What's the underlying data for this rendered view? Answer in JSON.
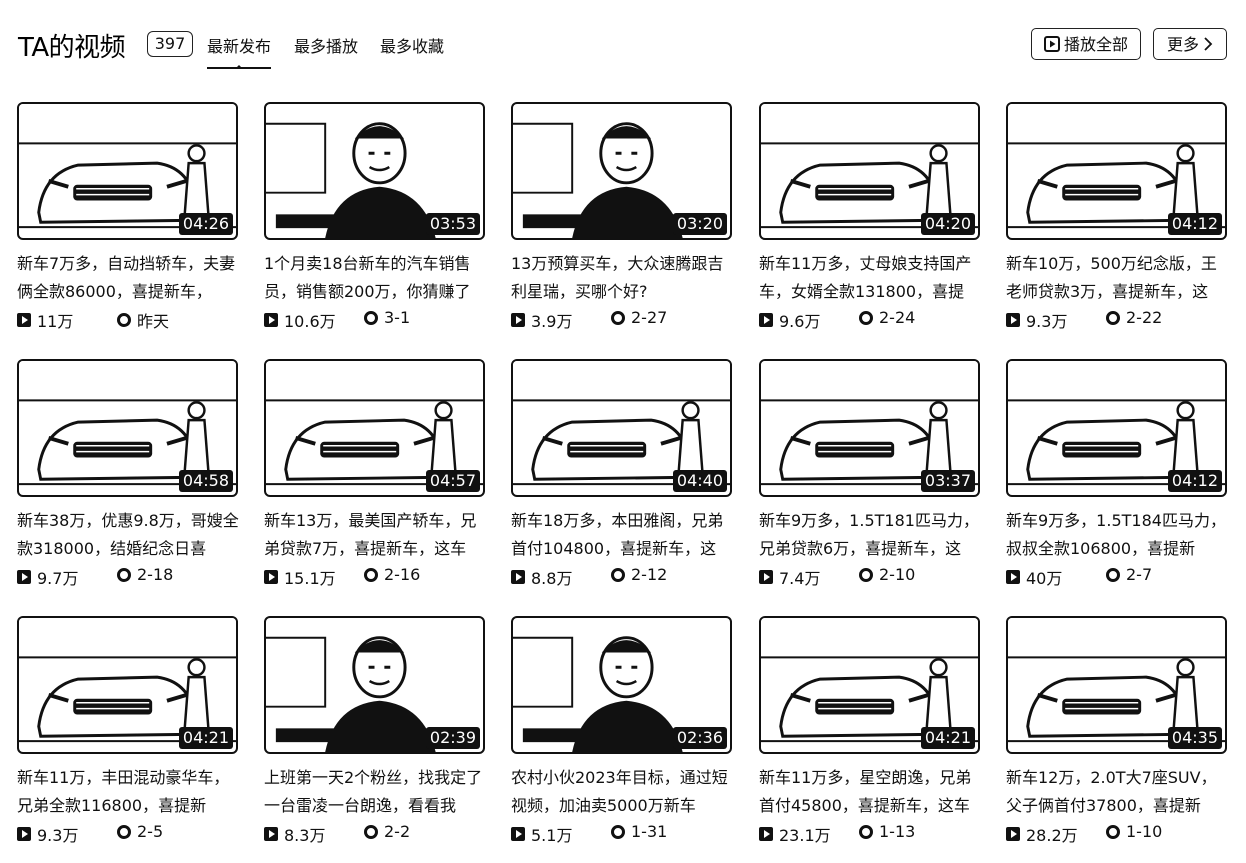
{
  "header": {
    "title": "TA的视频",
    "count": "397",
    "tabs": [
      "最新发布",
      "最多播放",
      "最多收藏"
    ],
    "play_all_label": "播放全部",
    "more_label": "更多"
  },
  "videos": [
    {
      "title": "新车7万多，自动挡轿车，夫妻俩全款86000，喜提新车，",
      "views": "11万",
      "date": "昨天",
      "duration": "04:26"
    },
    {
      "title": "1个月卖18台新车的汽车销售员，销售额200万，你猜赚了",
      "views": "10.6万",
      "date": "3-1",
      "duration": "03:53"
    },
    {
      "title": "13万预算买车，大众速腾跟吉利星瑞，买哪个好?",
      "views": "3.9万",
      "date": "2-27",
      "duration": "03:20"
    },
    {
      "title": "新车11万多，丈母娘支持国产车，女婿全款131800，喜提",
      "views": "9.6万",
      "date": "2-24",
      "duration": "04:20"
    },
    {
      "title": "新车10万，500万纪念版，王老师贷款3万，喜提新车，这",
      "views": "9.3万",
      "date": "2-22",
      "duration": "04:12"
    },
    {
      "title": "新车38万，优惠9.8万，哥嫂全款318000，结婚纪念日喜",
      "views": "9.7万",
      "date": "2-18",
      "duration": "04:58"
    },
    {
      "title": "新车13万，最美国产轿车，兄弟贷款7万，喜提新车，这车",
      "views": "15.1万",
      "date": "2-16",
      "duration": "04:57"
    },
    {
      "title": "新车18万多，本田雅阁，兄弟首付104800，喜提新车，这",
      "views": "8.8万",
      "date": "2-12",
      "duration": "04:40"
    },
    {
      "title": "新车9万多，1.5T181匹马力，兄弟贷款6万，喜提新车，这",
      "views": "7.4万",
      "date": "2-10",
      "duration": "03:37"
    },
    {
      "title": "新车9万多，1.5T184匹马力，叔叔全款106800，喜提新",
      "views": "40万",
      "date": "2-7",
      "duration": "04:12"
    },
    {
      "title": "新车11万，丰田混动豪华车，兄弟全款116800，喜提新",
      "views": "9.3万",
      "date": "2-5",
      "duration": "04:21"
    },
    {
      "title": "上班第一天2个粉丝，找我定了一台雷凌一台朗逸，看看我",
      "views": "8.3万",
      "date": "2-2",
      "duration": "02:39"
    },
    {
      "title": "农村小伙2023年目标，通过短视频，加油卖5000万新车",
      "views": "5.1万",
      "date": "1-31",
      "duration": "02:36"
    },
    {
      "title": "新车11万多，星空朗逸，兄弟首付45800，喜提新车，这车",
      "views": "23.1万",
      "date": "1-13",
      "duration": "04:21"
    },
    {
      "title": "新车12万，2.0T大7座SUV，父子俩首付37800，喜提新",
      "views": "28.2万",
      "date": "1-10",
      "duration": "04:35"
    }
  ]
}
